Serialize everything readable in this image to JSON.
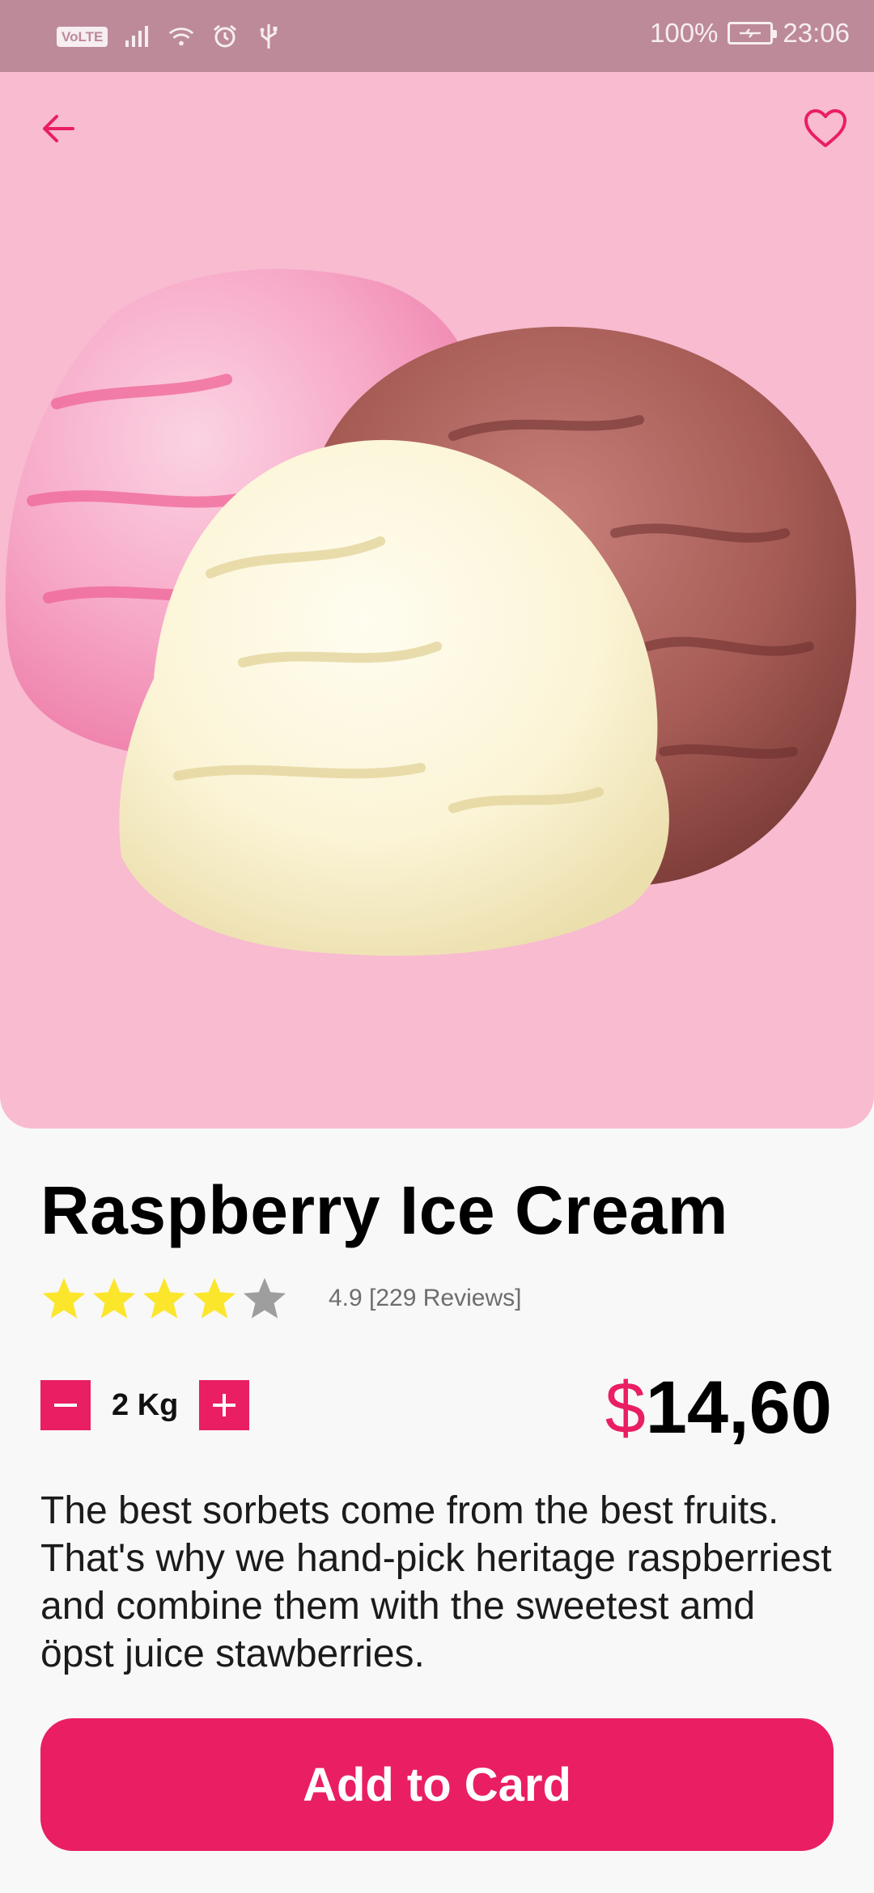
{
  "status_bar": {
    "network_badge": "VoLTE",
    "icons": [
      "signal-icon",
      "wifi-icon",
      "alarm-icon",
      "usb-icon"
    ],
    "battery_percent": "100%",
    "time": "23:06"
  },
  "header": {
    "back_icon": "arrow-left-icon",
    "favorite_icon": "heart-outline-icon"
  },
  "product": {
    "title": "Raspberry Ice Cream",
    "rating": {
      "stars_filled": 4,
      "stars_total": 5,
      "text": "4.9 [229 Reviews]"
    },
    "quantity": "2 Kg",
    "price": {
      "currency": "$",
      "amount": "14,60"
    },
    "description": "The best sorbets come from the best fruits. That's why we hand-pick heritage raspberriest and combine them with the sweetest amd öpst juice stawberries."
  },
  "cta": {
    "label": "Add to Card"
  },
  "colors": {
    "accent": "#e91e63",
    "hero_bg": "#f8bbd0",
    "status_bar_bg": "#bd8a99",
    "star_filled": "#fbe62c",
    "star_empty": "#9e9e9e"
  }
}
